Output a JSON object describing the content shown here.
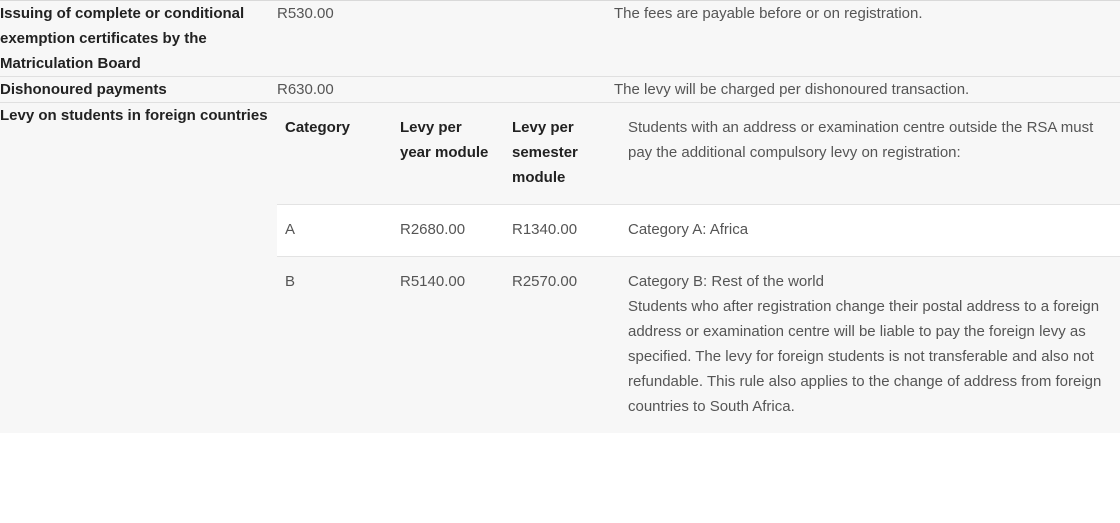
{
  "table": {
    "rows": [
      {
        "label": "Issuing of complete or conditional exemption certificates by the Matriculation Board",
        "amount": "R530.00",
        "description": "The fees are payable before or on registration."
      },
      {
        "label": "Dishonoured payments",
        "amount": "R630.00",
        "description": "The levy will be charged per dishonoured transaction."
      },
      {
        "label": "Levy on students in foreign countries",
        "description": "Students with an address or examination centre outside the RSA must pay the additional compulsory levy on registration:",
        "sub_table": {
          "headers": {
            "category": "Category",
            "levy_per_year_module": "Levy per year module",
            "levy_per_semester_module": "Levy per semester module"
          },
          "rows": [
            {
              "category": "A",
              "levy_per_year_module": "R2680.00",
              "levy_per_semester_module": "R1340.00",
              "description_lines": [
                "Category A: Africa"
              ]
            },
            {
              "category": "B",
              "levy_per_year_module": "R5140.00",
              "levy_per_semester_module": "R2570.00",
              "description_lines": [
                "Category B: Rest of the world",
                "Students who after registration change their postal address to a foreign address or examination centre will be liable to pay the foreign levy as specified. The levy for foreign students is not transferable and also not refundable. This rule also applies to the change of address from foreign countries to South Africa."
              ]
            }
          ]
        }
      }
    ]
  },
  "colors": {
    "page_background": "#ffffff",
    "row_background": "#f7f7f7",
    "highlight_row_background": "#ffffff",
    "border": "#e0e0e0",
    "label_text": "#222222",
    "body_text": "#555555"
  }
}
